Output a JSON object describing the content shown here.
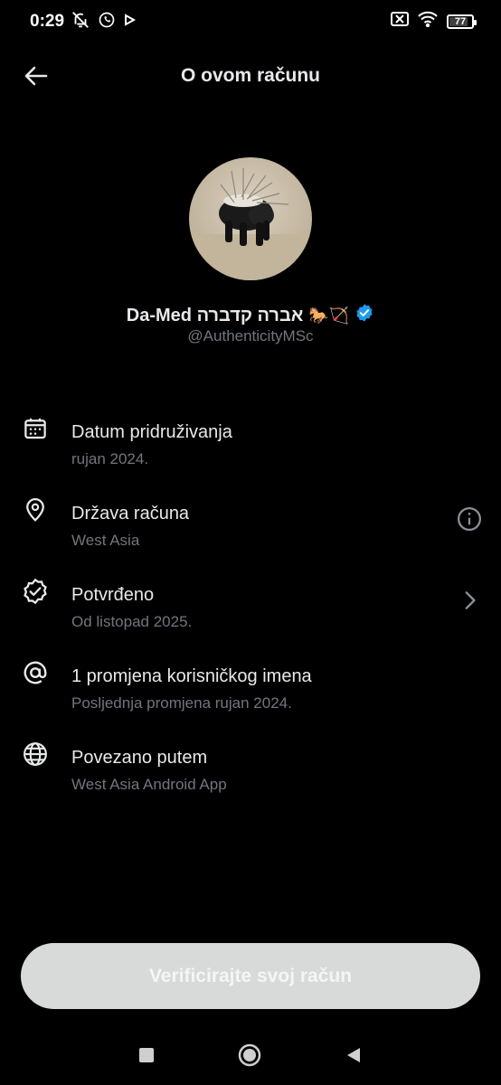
{
  "status_bar": {
    "time": "0:29",
    "left_icons": [
      "notifications-off-icon",
      "whatsapp-icon",
      "play-icon"
    ],
    "right_icons": [
      "no-sim-icon",
      "wifi-icon",
      "battery-icon"
    ],
    "battery_percent": "77",
    "battery_level": 0.77
  },
  "header": {
    "title": "O ovom računu",
    "back_icon": "arrow-left-icon"
  },
  "profile": {
    "display_name": "Da-Med אברה קדברה",
    "emoji": "🐎🏹",
    "verified": true,
    "handle": "@AuthenticityMSc"
  },
  "info_rows": [
    {
      "icon": "calendar-icon",
      "title": "Datum pridruživanja",
      "subtitle": "rujan 2024.",
      "trailing": null
    },
    {
      "icon": "location-pin-icon",
      "title": "Država računa",
      "subtitle": "West Asia",
      "trailing": "info-icon"
    },
    {
      "icon": "verified-badge-icon",
      "title": "Potvrđeno",
      "subtitle": "Od listopad 2025.",
      "trailing": "chevron-right-icon"
    },
    {
      "icon": "at-sign-icon",
      "title": "1 promjena korisničkog imena",
      "subtitle": "Posljednja promjena rujan 2024.",
      "trailing": null
    },
    {
      "icon": "globe-icon",
      "title": "Povezano putem",
      "subtitle": "West Asia Android App",
      "trailing": null
    }
  ],
  "verify_button": {
    "label": "Verificirajte svoj račun"
  },
  "nav_bar": {
    "items": [
      "recents-square-icon",
      "home-circle-icon",
      "back-triangle-icon"
    ]
  },
  "colors": {
    "background": "#000000",
    "primary_text": "#e7e9ea",
    "secondary_text": "#71767b",
    "verified_blue": "#1d9bf0",
    "button_bg": "#d8d9d9"
  }
}
